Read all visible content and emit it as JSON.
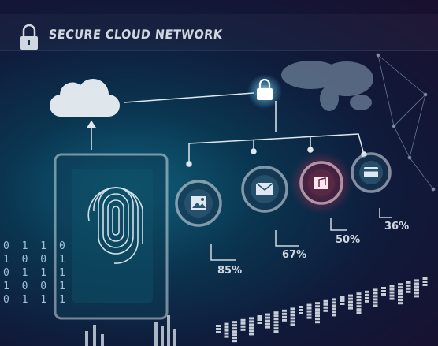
{
  "header": {
    "title": "SECURE CLOUD NETWORK"
  },
  "stats": [
    {
      "label": "85%",
      "icon": "image-icon",
      "value": 85
    },
    {
      "label": "67%",
      "icon": "mail-icon",
      "value": 67
    },
    {
      "label": "50%",
      "icon": "music-icon",
      "value": 50
    },
    {
      "label": "36%",
      "icon": "credit-card-icon",
      "value": 36
    }
  ],
  "binary": {
    "text": "0 1 1 0\n1 0 0 1\n0 1 1 1\n1 0 0 1\n0 1 1 1"
  },
  "colors": {
    "accent_cyan": "#5fd3ff",
    "accent_red": "#ff3355",
    "line": "#dfe8f0"
  }
}
